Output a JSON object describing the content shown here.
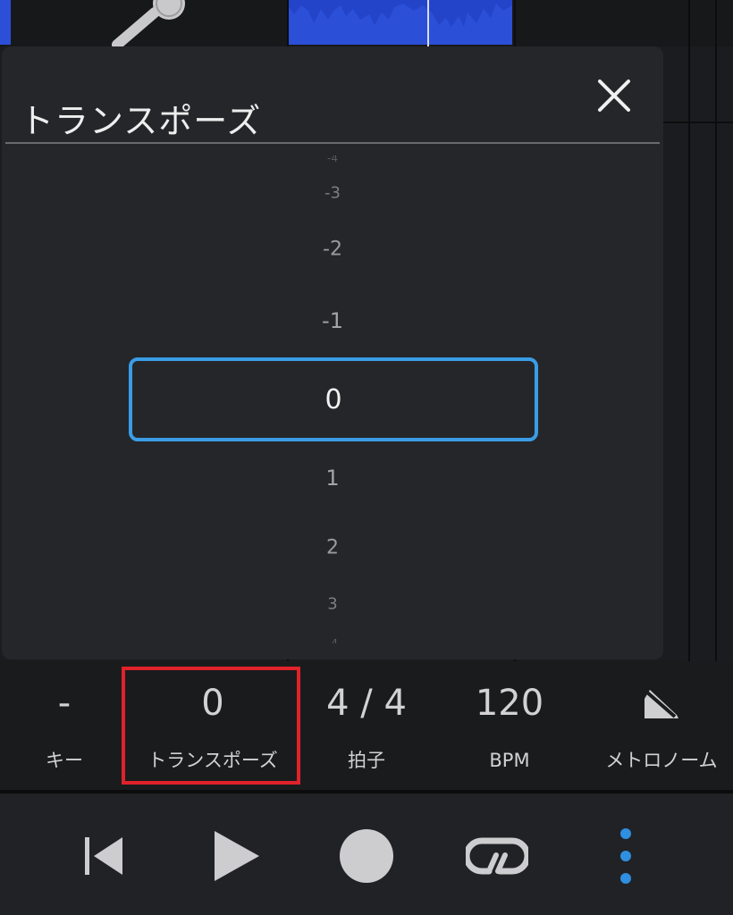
{
  "dialog": {
    "title": "トランスポーズ",
    "picker": {
      "items": [
        "-4",
        "-3",
        "-2",
        "-1",
        "0",
        "1",
        "2",
        "3",
        "-4"
      ],
      "selected": "0"
    }
  },
  "info_bar": {
    "key": {
      "value": "-",
      "label": "キー"
    },
    "transpose": {
      "value": "0",
      "label": "トランスポーズ"
    },
    "time_signature": {
      "value": "4 / 4",
      "label": "拍子"
    },
    "tempo": {
      "value": "120",
      "label": "BPM"
    },
    "metronome": {
      "label": "メトロノーム"
    }
  },
  "icons": {
    "close": "close-icon",
    "microphone": "microphone-icon",
    "metronome": "metronome-icon",
    "skip_back": "skip-back-icon",
    "play": "play-icon",
    "record": "record-icon",
    "loop": "loop-icon",
    "more": "more-vertical-icon"
  },
  "colors": {
    "accent_blue": "#3a9de6",
    "highlight_red": "#e0222a",
    "waveform_blue": "#2c4fd8",
    "dialog_bg": "#25262a",
    "more_dots": "#2f8fe0"
  }
}
